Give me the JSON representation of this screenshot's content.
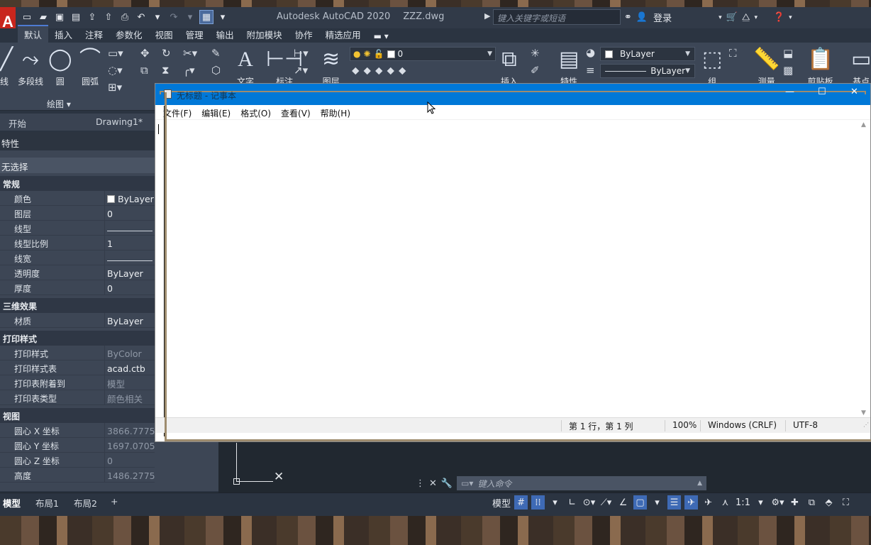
{
  "acad": {
    "logo": "A",
    "title_app": "Autodesk AutoCAD 2020",
    "title_file": "ZZZ.dwg",
    "search_placeholder": "键入关键字或短语",
    "login": "登录",
    "tabs": [
      "默认",
      "插入",
      "注释",
      "参数化",
      "视图",
      "管理",
      "输出",
      "附加模块",
      "协作",
      "精选应用"
    ],
    "ribbon": {
      "line_label": "直线",
      "polyline_label": "多段线",
      "circle_label": "圆",
      "arc_label": "圆弧",
      "draw_panel_title": "绘图 ▾",
      "text_label": "文字",
      "dimension_label": "标注",
      "layer_label": "图层",
      "layer_value": "0",
      "insert_label": "插入",
      "properties_label": "特性",
      "color_value": "ByLayer",
      "linetype_value": "ByLayer",
      "group_label": "组",
      "measure_label": "测量",
      "clipboard_label": "剪贴板",
      "base_label": "基点"
    },
    "doc_tabs": {
      "start": "开始",
      "drawing": "Drawing1*"
    }
  },
  "properties": {
    "title": "特性",
    "selection": "无选择",
    "sections": {
      "general": "常规",
      "threed": "三维效果",
      "plotstyle": "打印样式",
      "view": "视图"
    },
    "general_rows": [
      {
        "k": "颜色",
        "v": "ByLayer"
      },
      {
        "k": "图层",
        "v": "0"
      },
      {
        "k": "线型",
        "v": ""
      },
      {
        "k": "线型比例",
        "v": "1"
      },
      {
        "k": "线宽",
        "v": ""
      },
      {
        "k": "透明度",
        "v": "ByLayer"
      },
      {
        "k": "厚度",
        "v": "0"
      }
    ],
    "threed_rows": [
      {
        "k": "材质",
        "v": "ByLayer"
      }
    ],
    "plot_rows": [
      {
        "k": "打印样式",
        "v": "ByColor"
      },
      {
        "k": "打印样式表",
        "v": "acad.ctb"
      },
      {
        "k": "打印表附着到",
        "v": "模型"
      },
      {
        "k": "打印表类型",
        "v": "颜色相关"
      }
    ],
    "view_rows": [
      {
        "k": "圆心 X 坐标",
        "v": "3866.7775"
      },
      {
        "k": "圆心 Y 坐标",
        "v": "1697.0705"
      },
      {
        "k": "圆心 Z 坐标",
        "v": "0"
      },
      {
        "k": "高度",
        "v": "1486.2775"
      }
    ]
  },
  "command": {
    "placeholder": "键入命令"
  },
  "status": {
    "layout_tabs": [
      "模型",
      "布局1",
      "布局2"
    ],
    "model_button": "模型",
    "scale": "1:1"
  },
  "notepad": {
    "title": "无标题 - 记事本",
    "menu": [
      "文件(F)",
      "编辑(E)",
      "格式(O)",
      "查看(V)",
      "帮助(H)"
    ],
    "status_pos": "第 1 行，第 1 列",
    "status_zoom": "100%",
    "status_eol": "Windows (CRLF)",
    "status_enc": "UTF-8"
  },
  "colors": {
    "acad_bg": "#2b3441",
    "ribbon_bg": "#3c4656",
    "notepad_title": "#0078d7",
    "accent": "#3e6ab5"
  }
}
